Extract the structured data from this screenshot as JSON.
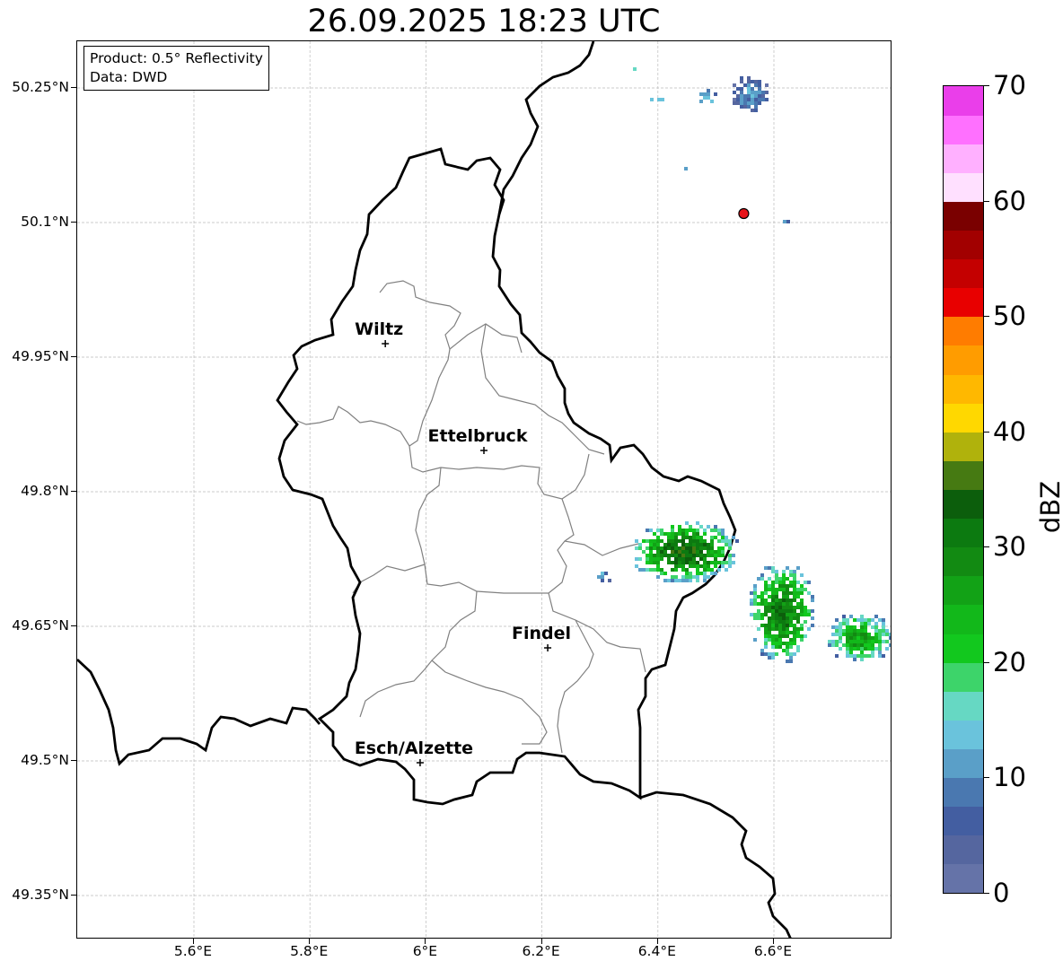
{
  "title": "26.09.2025 18:23 UTC",
  "info_box": {
    "product": "Product: 0.5° Reflectivity",
    "data": "Data: DWD"
  },
  "axes": {
    "lat_ticks": [
      "50.25°N",
      "50.1°N",
      "49.95°N",
      "49.8°N",
      "49.65°N",
      "49.5°N",
      "49.35°N"
    ],
    "lon_ticks": [
      "5.6°E",
      "5.8°E",
      "6°E",
      "6.2°E",
      "6.4°E",
      "6.6°E"
    ]
  },
  "cities": [
    {
      "name": "Wiltz",
      "lon": 5.93,
      "lat": 49.965
    },
    {
      "name": "Ettelbruck",
      "lon": 6.1,
      "lat": 49.846
    },
    {
      "name": "Findel",
      "lon": 6.21,
      "lat": 49.626
    },
    {
      "name": "Esch/Alzette",
      "lon": 5.99,
      "lat": 49.498
    }
  ],
  "radar_site": {
    "lon": 6.548,
    "lat": 50.11,
    "color": "#e8141a"
  },
  "colorbar": {
    "label": "dBZ",
    "min": 0,
    "max": 70,
    "tick_labels": [
      "0",
      "10",
      "20",
      "30",
      "40",
      "50",
      "60",
      "70"
    ],
    "colors": [
      "#6573a8",
      "#55669f",
      "#435ea1",
      "#4a78b0",
      "#5a9fc8",
      "#6ac3dc",
      "#66d8c3",
      "#3dd46a",
      "#12c81e",
      "#12b81a",
      "#12a216",
      "#128a12",
      "#0c7a10",
      "#0c5e0c",
      "#467a12",
      "#b0b20c",
      "#ffd800",
      "#ffb800",
      "#ff9c00",
      "#ff7c00",
      "#e80000",
      "#c40000",
      "#a20000",
      "#7a0000",
      "#ffe0ff",
      "#ffb0ff",
      "#ff70ff",
      "#ea3eea"
    ]
  }
}
